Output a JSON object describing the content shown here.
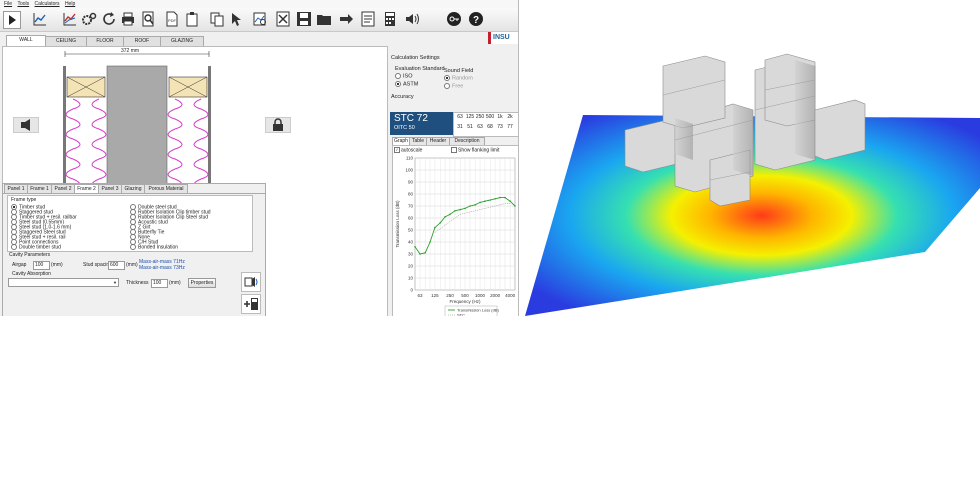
{
  "menu": [
    "File",
    "Tools",
    "Calculators",
    "Help"
  ],
  "toolbar_icons": [
    "play-icon",
    "line-graph-icon",
    "bar-graph-icon",
    "gears-icon",
    "refresh-icon",
    "print-icon",
    "print-preview-icon",
    "pdf-icon",
    "clipboard-icon",
    "copy-icon",
    "cursor-icon",
    "search-icon",
    "image-icon",
    "delete-icon",
    "save-icon",
    "open-folder-icon",
    "export-icon",
    "report-icon",
    "calculator-icon",
    "speaker-icon",
    "key-icon",
    "help-icon"
  ],
  "brand": "INSU",
  "tabs": [
    "WALL",
    "CEILING",
    "FLOOR",
    "ROOF",
    "GLAZING"
  ],
  "drawing": {
    "dimension": "372 mm"
  },
  "settings": {
    "title": "Calculation Settings",
    "eval_label": "Evaluation Standard",
    "eval_options": [
      "ISO",
      "ASTM"
    ],
    "sound_label": "Sound Field",
    "sound_options": [
      "Random",
      "Free"
    ],
    "accuracy_label": "Accuracy"
  },
  "rating": {
    "stc": "STC 72",
    "oitc": "OITC 50"
  },
  "bands": {
    "freqs": [
      "63",
      "125",
      "250",
      "500",
      "1k",
      "2k"
    ],
    "values": [
      "31",
      "51",
      "63",
      "68",
      "73",
      "77"
    ]
  },
  "graph_tabs": [
    "Graph",
    "Table",
    "Header",
    "Description"
  ],
  "graph_options": {
    "autoscale": "autoscale",
    "flanking": "Show flanking limit"
  },
  "chart_data": {
    "type": "line",
    "ylabel": "Transmission Loss (dB)",
    "xlabel": "Frequency (Hz)",
    "ylim": [
      0,
      110
    ],
    "yticks": [
      "0",
      "10",
      "20",
      "30",
      "40",
      "50",
      "60",
      "70",
      "80",
      "90",
      "100",
      "110"
    ],
    "xticks": [
      "63",
      "125",
      "250",
      "500",
      "1000",
      "2000",
      "4000"
    ],
    "legend": [
      "Transmission Loss (dB)",
      "STC"
    ],
    "series": [
      {
        "name": "Transmission Loss (dB)",
        "points": [
          [
            50,
            36
          ],
          [
            63,
            30
          ],
          [
            80,
            31
          ],
          [
            100,
            40
          ],
          [
            125,
            52
          ],
          [
            160,
            56
          ],
          [
            200,
            61
          ],
          [
            250,
            63
          ],
          [
            315,
            66
          ],
          [
            400,
            67
          ],
          [
            500,
            68
          ],
          [
            630,
            70
          ],
          [
            800,
            71
          ],
          [
            1000,
            73
          ],
          [
            1250,
            74
          ],
          [
            1600,
            75
          ],
          [
            2000,
            76
          ],
          [
            2500,
            77
          ],
          [
            3150,
            77
          ],
          [
            4000,
            74
          ],
          [
            5000,
            70
          ]
        ]
      },
      {
        "name": "STC",
        "points": [
          [
            125,
            48
          ],
          [
            160,
            51
          ],
          [
            200,
            54
          ],
          [
            250,
            57
          ],
          [
            315,
            60
          ],
          [
            400,
            63
          ],
          [
            500,
            64
          ],
          [
            630,
            65
          ],
          [
            800,
            66
          ],
          [
            1000,
            67
          ],
          [
            1250,
            68
          ],
          [
            1600,
            69
          ],
          [
            2000,
            70
          ],
          [
            2500,
            71
          ],
          [
            3150,
            72
          ],
          [
            4000,
            72
          ]
        ]
      }
    ]
  },
  "panel_tabs": [
    "Panel 1",
    "Frame 1",
    "Panel 2",
    "Frame 2",
    "Panel 3",
    "Glazing",
    "Porous Material"
  ],
  "frame": {
    "title": "Frame type",
    "left_options": [
      "Timber stud",
      "Staggered stud",
      "Timber stud + resil. railbar",
      "Steel stud (0.55mm)",
      "Steel stud (1.0-1.6 mm)",
      "Staggered Steel stud",
      "Steel stud + resil. rail",
      "Point connections",
      "Double timber stud"
    ],
    "right_options": [
      "Double steel stud",
      "Rubber Isolation Clip timber stud",
      "Rubber Isolation Clip Steel stud",
      "Acoustic stud",
      "Z Girt",
      "Butterfly Tie",
      "None",
      "C/H Stud",
      "Bonded Insulation"
    ],
    "selected": "Timber stud"
  },
  "cavity": {
    "title": "Cavity Parameters",
    "airgap_label": "Airgap",
    "airgap_value": "100",
    "unit": "(mm)",
    "spacing_label": "Stud spacing",
    "spacing_value": "600",
    "mass1": "Mass-air-mass 71Hz",
    "mass2": "Mass-air-mass 73Hz",
    "absorption_label": "Cavity Absorption",
    "thickness_label": "Thickness",
    "thickness_value": "100",
    "properties_label": "Properties"
  }
}
